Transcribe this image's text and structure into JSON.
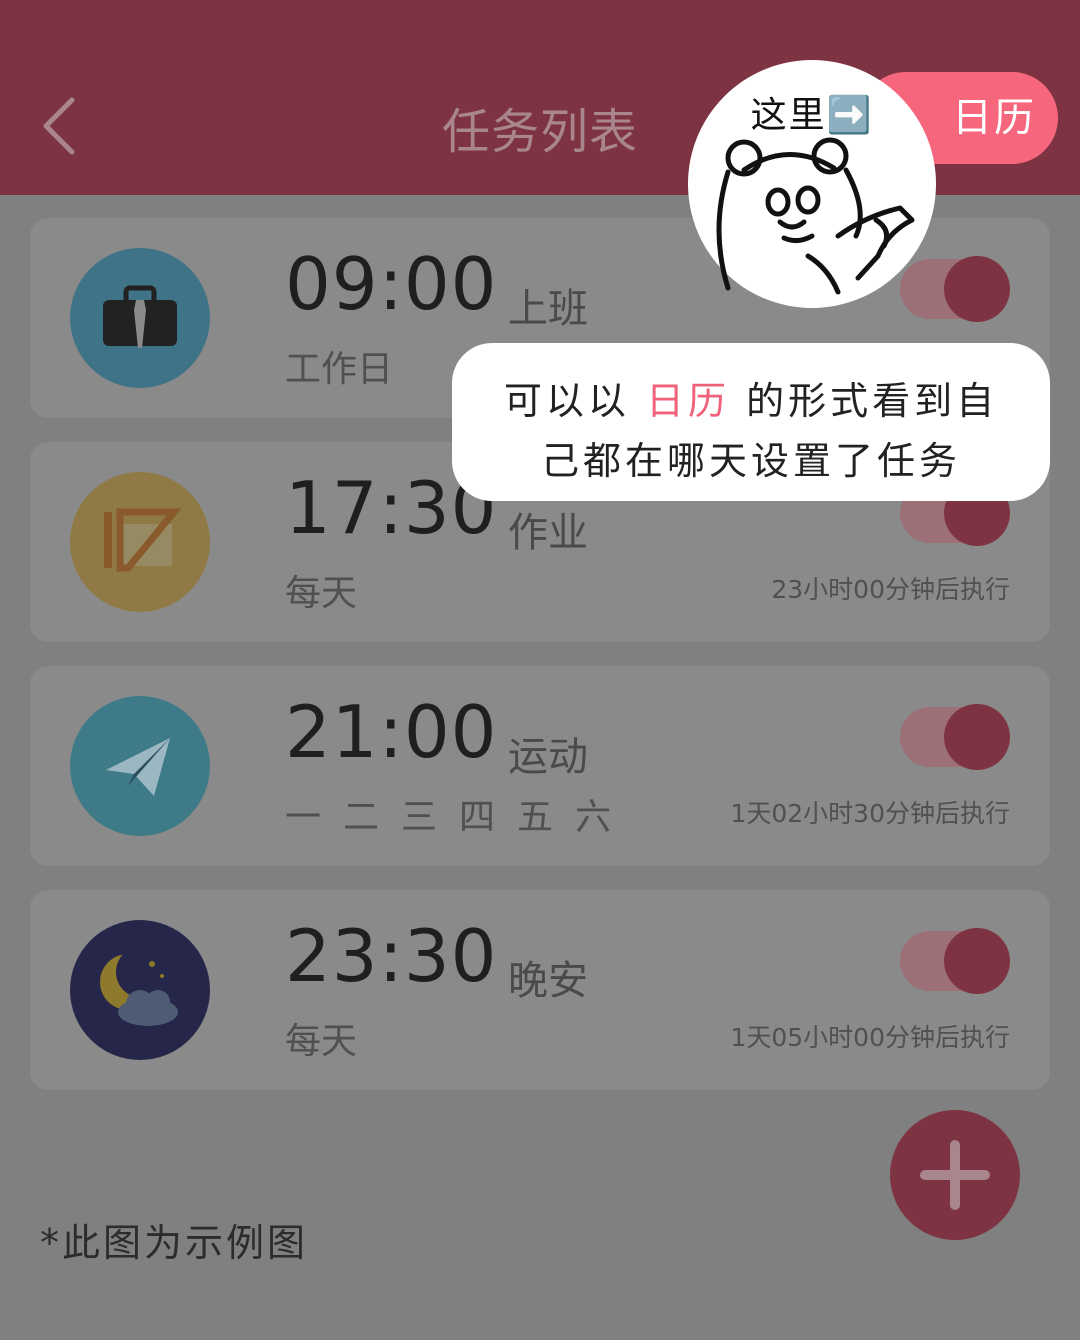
{
  "header": {
    "title": "任务列表",
    "calendar_button": "日历"
  },
  "tasks": [
    {
      "time": "09:00",
      "name": "上班",
      "repeat": "工作日",
      "remaining": "",
      "enabled": true,
      "icon": "briefcase-icon"
    },
    {
      "time": "17:30",
      "name": "作业",
      "repeat": "每天",
      "remaining": "23小时00分钟后执行",
      "enabled": true,
      "icon": "ruler-triangle-icon"
    },
    {
      "time": "21:00",
      "name": "运动",
      "repeat": "一二三四五六",
      "remaining": "1天02小时30分钟后执行",
      "enabled": true,
      "icon": "paper-plane-icon"
    },
    {
      "time": "23:30",
      "name": "晚安",
      "repeat": "每天",
      "remaining": "1天05小时00分钟后执行",
      "enabled": true,
      "icon": "moon-cloud-icon"
    }
  ],
  "tooltip": {
    "bear_caption": "这里➡️",
    "line1_pre": "可以以",
    "line1_highlight": "日历",
    "line1_post": "的形式看到自",
    "line2": "己都在哪天设置了任务"
  },
  "footnote": "*此图为示例图",
  "colors": {
    "header": "#7d3341",
    "accent_pink": "#f6677d",
    "toggle_knob": "#7d3341",
    "overlay_gray": "#808080"
  }
}
